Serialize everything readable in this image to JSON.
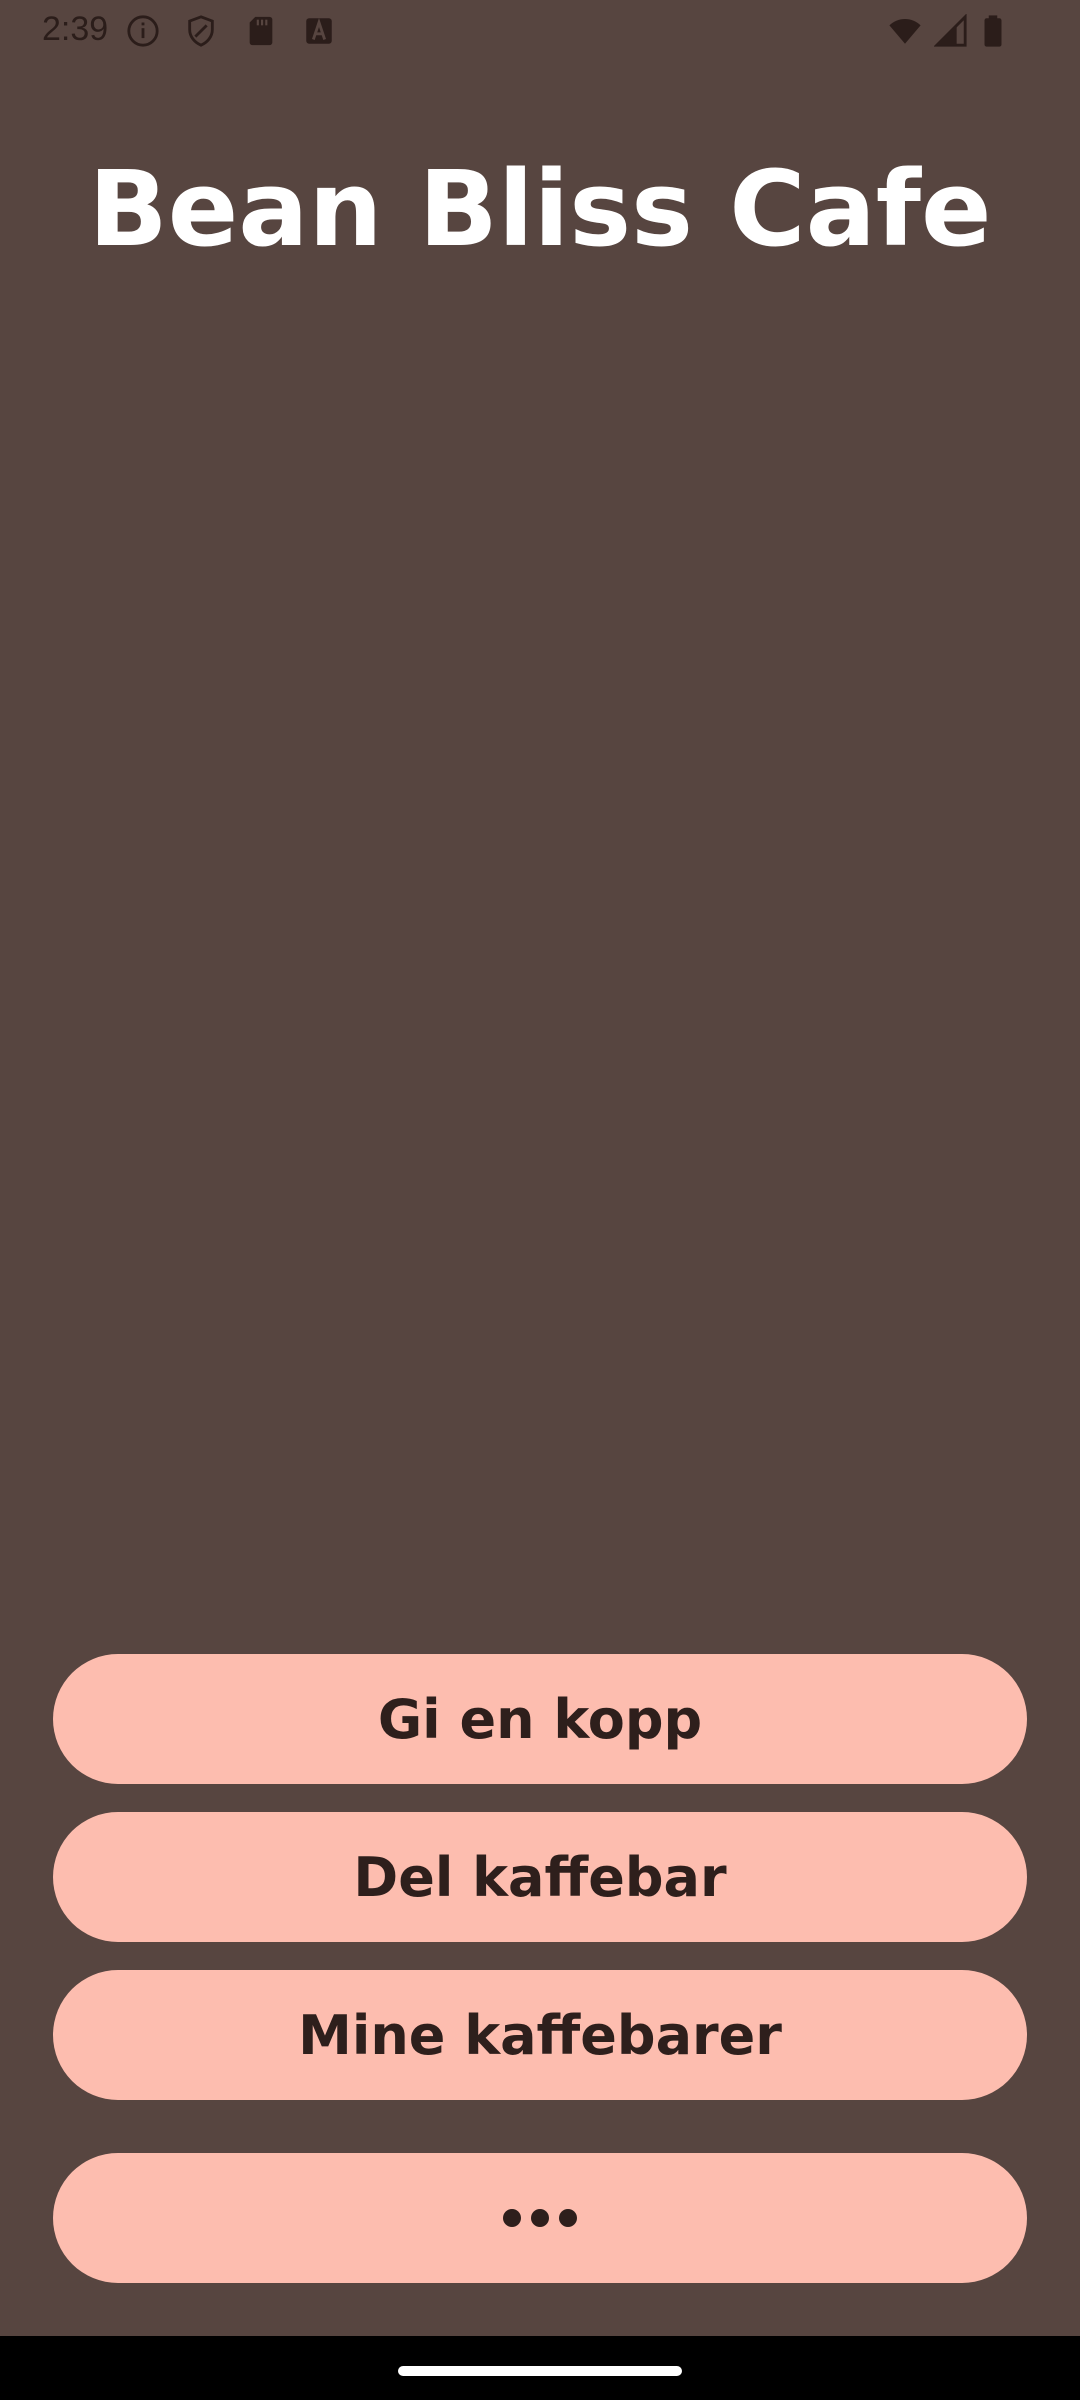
{
  "status_bar": {
    "time": "2:39",
    "icons_left": [
      "info-icon",
      "shield-icon",
      "sd-card-icon",
      "a-icon"
    ],
    "icons_right": [
      "wifi-icon",
      "signal-icon",
      "battery-icon"
    ]
  },
  "app": {
    "title": "Bean Bliss Cafe"
  },
  "actions": {
    "give_cup": "Gi en kopp",
    "share_cafe": "Del kaffebar",
    "my_cafes": "Mine kaffebarer",
    "more_icon": "more-icon"
  },
  "colors": {
    "background": "#574540",
    "button": "#fdbdaf",
    "button_text": "#2e1f1c",
    "title": "#ffffff"
  }
}
